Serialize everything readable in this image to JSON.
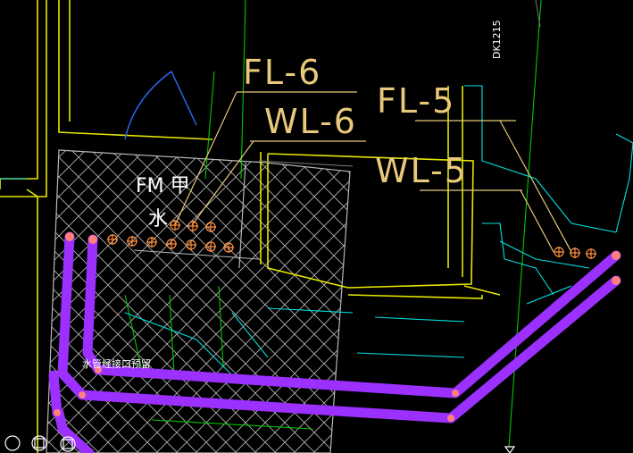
{
  "labels": {
    "fl6": "FL-6",
    "wl6": "WL-6",
    "fl5": "FL-5",
    "wl5": "WL-5",
    "room_fm": "FM 甲",
    "room_water": "水",
    "pipe_note": "水管经接口预留",
    "grid_ref": "DK1215"
  },
  "colors": {
    "background": "#000000",
    "wall": "#e6e600",
    "pipe": "#9b30ff",
    "pipe_end": "#ff7f7f",
    "leader": "#e8c87a",
    "hatch": "#b8b8b8",
    "cyan": "#00e0e0",
    "green": "#00c800",
    "door": "#2a6cff"
  }
}
